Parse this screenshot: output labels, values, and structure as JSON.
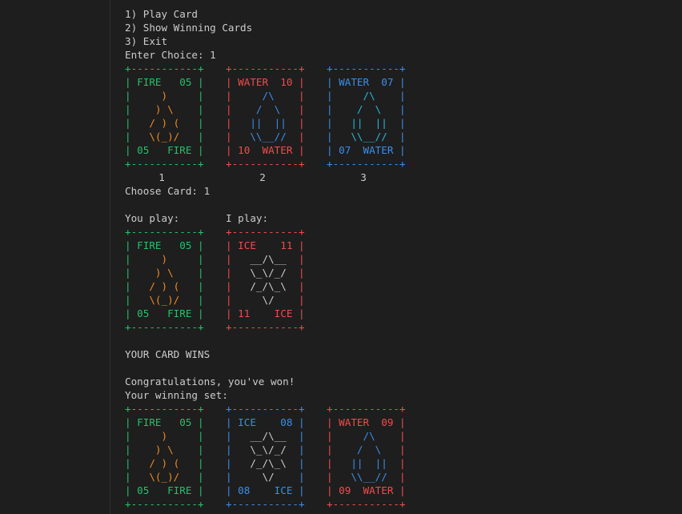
{
  "menu": {
    "items": [
      "1) Play Card",
      "2) Show Winning Cards",
      "3) Exit"
    ],
    "prompt": "Enter Choice: 1"
  },
  "hand": {
    "cards": [
      {
        "color": "#23c16b",
        "art_color": "#f08a24",
        "lines": [
          "+-----------+",
          "| FIRE   05 |",
          "|     )     |",
          "|    ) \\    |",
          "|   / ) (   |",
          "|   \\(_)/   |",
          "| 05   FIRE |",
          "+-----------+"
        ]
      },
      {
        "color": "#f14c4c",
        "art_color": "#3b8eea",
        "lines": [
          "+-----------+",
          "| WATER  10 |",
          "|     /\\    |",
          "|    /  \\   |",
          "|   ||  ||  |",
          "|   \\\\__//  |",
          "| 10  WATER |",
          "+-----------+"
        ]
      },
      {
        "color": "#3b8eea",
        "art_color": "#29b8db",
        "lines": [
          "+-----------+",
          "| WATER  07 |",
          "|     /\\    |",
          "|    /  \\   |",
          "|   ||  ||  |",
          "|   \\\\__//  |",
          "| 07  WATER |",
          "+-----------+"
        ]
      }
    ],
    "numbers": [
      "1",
      "2",
      "3"
    ]
  },
  "choose_prompt": "Choose Card: 1",
  "play": {
    "you_label": "You play:",
    "i_label": "I play:",
    "cards": [
      {
        "color": "#23c16b",
        "art_color": "#f08a24",
        "lines": [
          "+-----------+",
          "| FIRE   05 |",
          "|     )     |",
          "|    ) \\    |",
          "|   / ) (   |",
          "|   \\(_)/   |",
          "| 05   FIRE |",
          "+-----------+"
        ]
      },
      {
        "color": "#f14c4c",
        "art_color": "#cccccc",
        "lines": [
          "+-----------+",
          "| ICE    11 |",
          "|   __/\\__  |",
          "|   \\_\\/_/  |",
          "|   /_/\\_\\  |",
          "|     \\/    |",
          "| 11    ICE |",
          "+-----------+"
        ]
      }
    ]
  },
  "result": "YOUR CARD WINS",
  "congrats": "Congratulations, you've won!",
  "winning_label": "Your winning set:",
  "winning": {
    "cards": [
      {
        "color": "#23c16b",
        "art_color": "#f08a24",
        "lines": [
          "+-----------+",
          "| FIRE   05 |",
          "|     )     |",
          "|    ) \\    |",
          "|   / ) (   |",
          "|   \\(_)/   |",
          "| 05   FIRE |",
          "+-----------+"
        ]
      },
      {
        "color": "#3b8eea",
        "art_color": "#cccccc",
        "lines": [
          "+-----------+",
          "| ICE    08 |",
          "|   __/\\__  |",
          "|   \\_\\/_/  |",
          "|   /_/\\_\\  |",
          "|     \\/    |",
          "| 08    ICE |",
          "+-----------+"
        ]
      },
      {
        "color": "#f14c4c",
        "art_color": "#3b8eea",
        "lines": [
          "+-----------+",
          "| WATER  09 |",
          "|     /\\    |",
          "|    /  \\   |",
          "|   ||  ||  |",
          "|   \\\\__//  |",
          "| 09  WATER |",
          "+-----------+"
        ]
      }
    ]
  },
  "colors": {
    "background": "#1e1e1e",
    "text": "#cccccc"
  }
}
